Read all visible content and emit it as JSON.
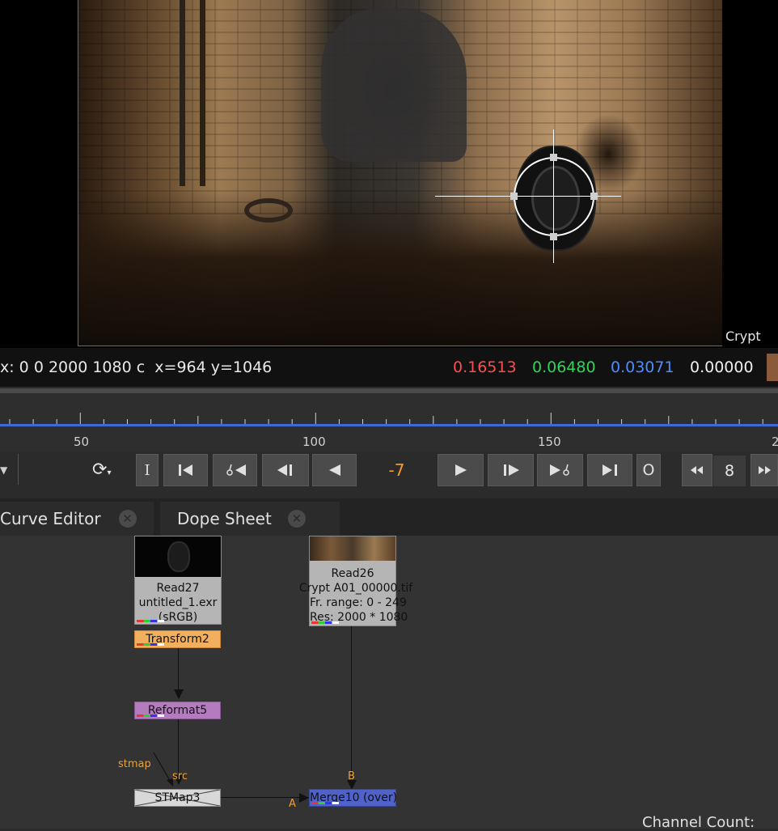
{
  "viewer": {
    "label": "Crypt",
    "bbox_text": "x: 0 0 2000 1080 c",
    "cursor_text": "x=964 y=1046",
    "pixel_values": {
      "r": "0.16513",
      "g": "0.06480",
      "b": "0.03071",
      "a": "0.00000"
    },
    "swatch_color": "#8a5a3a"
  },
  "timeline": {
    "labels": [
      "50",
      "100",
      "150",
      "2"
    ],
    "accent": "#3d6bd6"
  },
  "transport": {
    "in_label": "I",
    "out_label": "O",
    "frame_value": "-7",
    "step_value": "8",
    "frame_color": "#f39c2a"
  },
  "tabs": [
    {
      "label": "Curve Editor"
    },
    {
      "label": "Dope Sheet"
    }
  ],
  "nodes": {
    "read27": {
      "name": "Read27",
      "file": "untitled_1.exr",
      "colorspace": "(sRGB)"
    },
    "read26": {
      "name": "Read26",
      "file": "Crypt A01_00000.tif",
      "range": "Fr. range: 0 - 249",
      "res": "Res: 2000 * 1080"
    },
    "transform": {
      "name": "Transform2"
    },
    "reformat": {
      "name": "Reformat5"
    },
    "stmap": {
      "name": "STMap3"
    },
    "merge": {
      "name": "Merge10 (over)"
    }
  },
  "pins": {
    "stmap": "stmap",
    "src": "src",
    "b": "B",
    "a": "A"
  },
  "channel_count": "Channel Count:"
}
